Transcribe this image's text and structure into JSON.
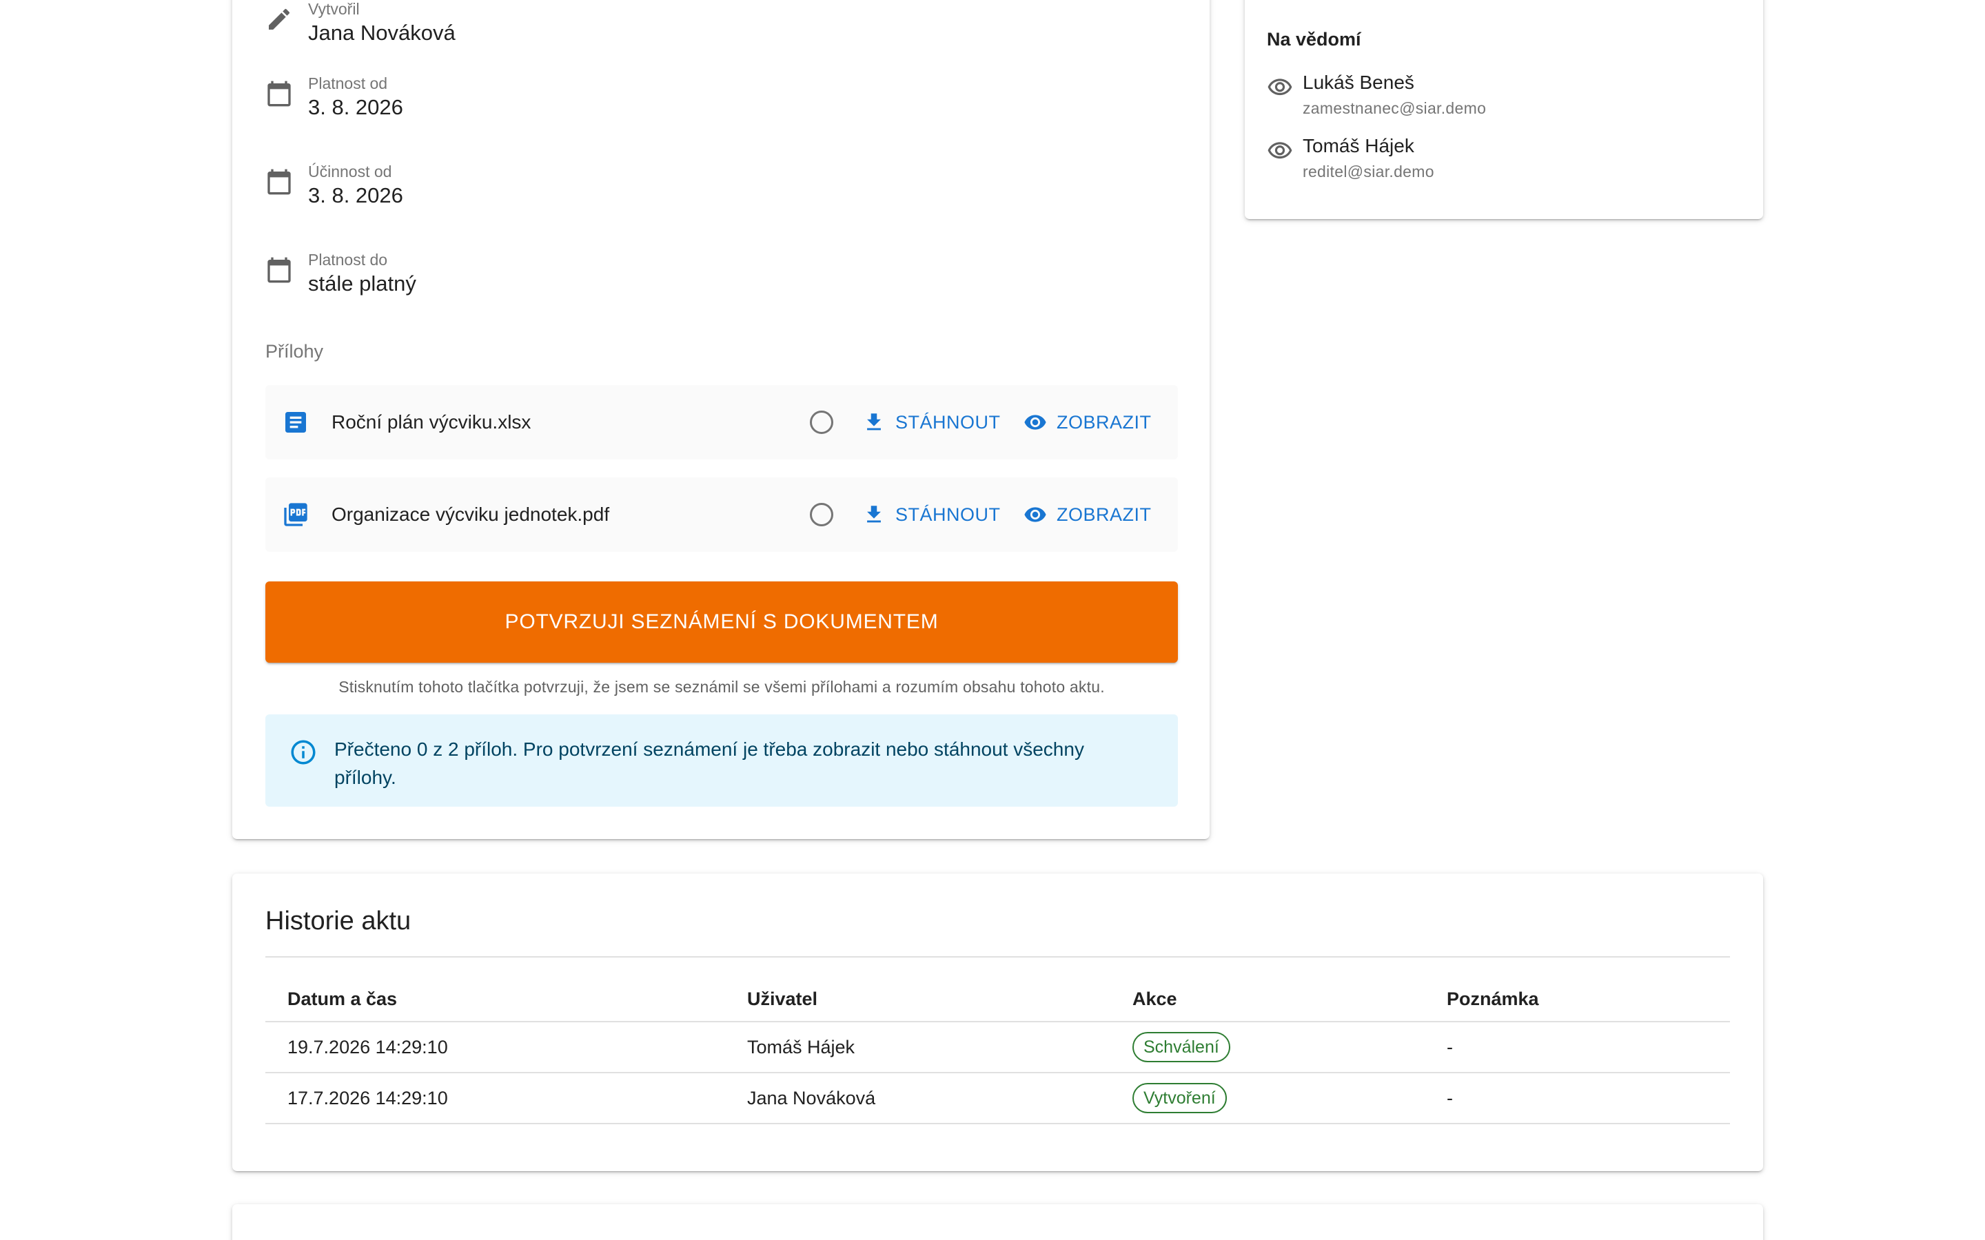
{
  "main": {
    "fields": [
      {
        "label": "Vytvořil",
        "value": "Jana Nováková",
        "icon": "pencil-icon"
      },
      {
        "label": "Platnost od",
        "value": "3. 8. 2026",
        "icon": "calendar-icon"
      },
      {
        "label": "Účinnost od",
        "value": "3. 8. 2026",
        "icon": "calendar-icon"
      },
      {
        "label": "Platnost do",
        "value": "stále platný",
        "icon": "calendar-icon"
      }
    ],
    "attachments_title": "Přílohy",
    "attachments": [
      {
        "name": "Roční plán výcviku.xlsx",
        "icon": "document-icon",
        "read": false
      },
      {
        "name": "Organizace výcviku jednotek.pdf",
        "icon": "pdf-icon",
        "read": false
      }
    ],
    "download_label": "STÁHNOUT",
    "view_label": "ZOBRAZIT",
    "confirm_label": "POTVRZUJI SEZNÁMENÍ S DOKUMENTEM",
    "confirm_note": "Stisknutím tohoto tlačítka potvrzuji, že jsem se seznámil se všemi přílohami a rozumím obsahu tohoto aktu.",
    "info_text": "Přečteno 0 z 2 příloh. Pro potvrzení seznámení je třeba zobrazit nebo stáhnout všechny přílohy."
  },
  "side": {
    "title": "Na vědomí",
    "people": [
      {
        "name": "Lukáš Beneš",
        "email": "zamestnanec@siar.demo"
      },
      {
        "name": "Tomáš Hájek",
        "email": "reditel@siar.demo"
      }
    ]
  },
  "history": {
    "title": "Historie aktu",
    "columns": [
      "Datum a čas",
      "Uživatel",
      "Akce",
      "Poznámka"
    ],
    "rows": [
      {
        "datetime": "19.7.2026 14:29:10",
        "user": "Tomáš Hájek",
        "action": "Schválení",
        "note": "-"
      },
      {
        "datetime": "17.7.2026 14:29:10",
        "user": "Jana Nováková",
        "action": "Vytvoření",
        "note": "-"
      }
    ]
  },
  "colors": {
    "primary": "#1976d2",
    "confirm": "#ef6c00",
    "info_bg": "#e5f6fd",
    "success": "#2e7d32"
  }
}
